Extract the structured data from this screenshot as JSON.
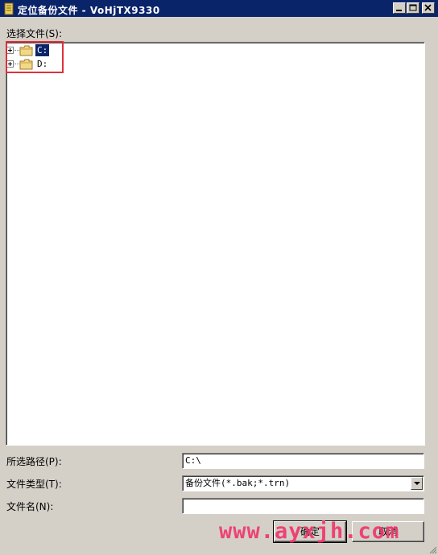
{
  "window": {
    "title": "定位备份文件 - VoHjTX9330"
  },
  "file_picker": {
    "label": "选择文件(S):",
    "nodes": [
      {
        "label": "C:",
        "selected": true,
        "icon": "folder-icon"
      },
      {
        "label": "D:",
        "selected": false,
        "icon": "folder-icon"
      }
    ],
    "highlight_color": "#e0303a",
    "selection_color": "#0a246a"
  },
  "fields": {
    "path_label": "所选路径(P):",
    "path_value": "C:\\",
    "type_label": "文件类型(T):",
    "type_value": "备份文件(*.bak;*.trn)",
    "name_label": "文件名(N):",
    "name_value": ""
  },
  "buttons": {
    "ok": "确定",
    "cancel": "取消"
  },
  "watermark": {
    "text": "www.ayxjh.com",
    "color": "#f0366e"
  },
  "colors": {
    "titlebar": "#0a246a",
    "face": "#d4d0c8"
  }
}
